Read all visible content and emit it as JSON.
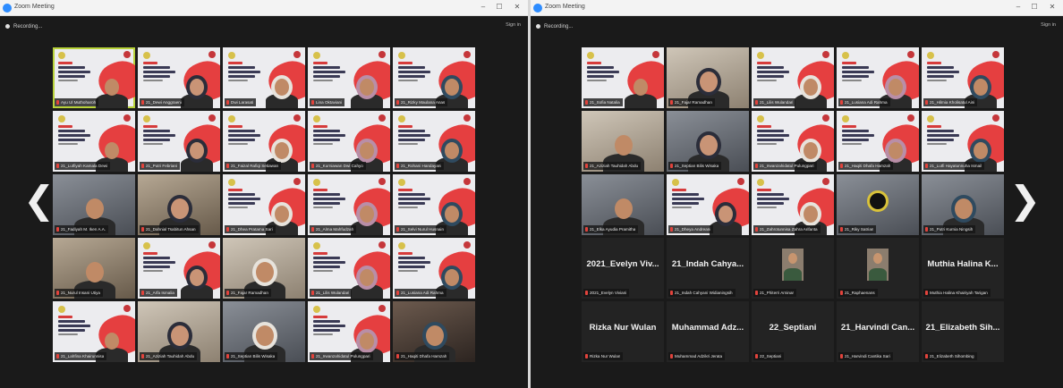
{
  "left_window": {
    "title": "Zoom Meeting",
    "recording": "Recording...",
    "sign_in": "Sign in",
    "controls": {
      "minimize": "–",
      "restore": "☐",
      "close": "✕"
    },
    "tiles": [
      {
        "kind": "slide",
        "name": "Ayu Ul Muthoharoh",
        "selected": true
      },
      {
        "kind": "slide",
        "name": "21_Dewi Anggraeni"
      },
      {
        "kind": "slide",
        "name": "Dwi Larasati"
      },
      {
        "kind": "slide",
        "name": "Lina Oktaviani"
      },
      {
        "kind": "slide",
        "name": "21_Rizky Maulana Anas"
      },
      {
        "kind": "slide",
        "name": "21_Lutfiyah Kamala Dewi"
      },
      {
        "kind": "slide",
        "name": "21_Putri Febriani"
      },
      {
        "kind": "slide",
        "name": "21_Faizal Rafiqi Setiawan"
      },
      {
        "kind": "slide",
        "name": "21_Kurniawan Dwi Cahyo"
      },
      {
        "kind": "slide",
        "name": "21_Rohani Handayani"
      },
      {
        "kind": "cam",
        "name": "21_Fadiyah M. Iken A.A."
      },
      {
        "kind": "cam",
        "name": "21_Dahnial Tsabitun Ahsan"
      },
      {
        "kind": "slide",
        "name": "21_Dhea Pratama Sari"
      },
      {
        "kind": "slide",
        "name": "21_Alma Mahfudzah"
      },
      {
        "kind": "slide",
        "name": "21_Selvi Nurul Husnain"
      },
      {
        "kind": "cam",
        "name": "21_Nurul Insani Utiya"
      },
      {
        "kind": "slide",
        "name": "21_Arfa Ismalia"
      },
      {
        "kind": "cam",
        "name": "21_Fajar Ramadhan"
      },
      {
        "kind": "slide",
        "name": "21_Lilis Wulandari"
      },
      {
        "kind": "slide",
        "name": "21_Lusiana Adi Rahma"
      },
      {
        "kind": "slide",
        "name": "21_Lahfina Khairunnisa"
      },
      {
        "kind": "cam",
        "name": "21_Aziziah Tauhidah Abdu"
      },
      {
        "kind": "cam",
        "name": "21_Septian Bilis Wisaka"
      },
      {
        "kind": "slide",
        "name": "21_Irwanzahidatul Pulungpari"
      },
      {
        "kind": "cam",
        "name": "21_Haqiti Dhafa Hamzah"
      }
    ]
  },
  "right_window": {
    "title": "Zoom Meeting",
    "recording": "Recording...",
    "sign_in": "Sign in",
    "controls": {
      "minimize": "–",
      "restore": "☐",
      "close": "✕"
    },
    "tiles": [
      {
        "kind": "slide",
        "name": "21_Sofia Natalia"
      },
      {
        "kind": "cam",
        "name": "21_Fajar Ramadhan"
      },
      {
        "kind": "slide",
        "name": "21_Lilis Wulandari"
      },
      {
        "kind": "slide",
        "name": "21_Lusiana Adi Rahma"
      },
      {
        "kind": "slide",
        "name": "21_Hilmia Kholisatul Aini"
      },
      {
        "kind": "cam",
        "name": "21_Aziziah Tauhidah Abdu"
      },
      {
        "kind": "cam",
        "name": "21_Septian Bilis Wisaka"
      },
      {
        "kind": "slide",
        "name": "21_Irwanzahidatul Pulungpari"
      },
      {
        "kind": "slide",
        "name": "21_Haqiti Dhafa Hamzah"
      },
      {
        "kind": "slide",
        "name": "21_Lutfi Hayatunnuha Ismail"
      },
      {
        "kind": "cam",
        "name": "21_Elka Ayudia Pramitha"
      },
      {
        "kind": "slide",
        "name": "21_Dheya Andreani"
      },
      {
        "kind": "slide",
        "name": "21_Zahrotunnisa Zahra Arifanta"
      },
      {
        "kind": "logo",
        "name": "21_Riky Satrian"
      },
      {
        "kind": "cam",
        "name": "21_Putri Kurnia Ningsih"
      },
      {
        "kind": "nameonly",
        "big": "2021_Evelyn Viv...",
        "name": "2021_Evelyn Viviani"
      },
      {
        "kind": "nameonly",
        "big": "21_Indah Cahya...",
        "name": "21_Indah Cahyani Widianingsih"
      },
      {
        "kind": "photo",
        "name": "21_Phiterri Arninar"
      },
      {
        "kind": "photo",
        "name": "21_Raphaenans"
      },
      {
        "kind": "nameonly",
        "big": "Muthia Halina K...",
        "name": "Muthia Halina Khairiyah Tarigan"
      },
      {
        "kind": "nameonly",
        "big": "Rizka Nur Wulan",
        "name": "Rizka Nur Wulan"
      },
      {
        "kind": "nameonly",
        "big": "Muhammad Adz...",
        "name": "Muhammad Adzikri Jerata"
      },
      {
        "kind": "nameonly",
        "big": "22_Septiani",
        "name": "22_Septiani"
      },
      {
        "kind": "nameonly",
        "big": "21_Harvindi Can...",
        "name": "21_Harvindi Cantika Sari"
      },
      {
        "kind": "nameonly",
        "big": "21_Elizabeth Sih...",
        "name": "21_Elizabeth Sihombing"
      }
    ]
  },
  "nav": {
    "prev_icon": "chevron-left-icon",
    "next_icon": "chevron-right-icon",
    "prev_glyph": "❮",
    "next_glyph": "❯"
  },
  "colors": {
    "accent_selected": "#b8d23a",
    "mic_muted": "#e2433c",
    "slide_red": "#e53636",
    "window_bg": "#1a1a1a"
  }
}
